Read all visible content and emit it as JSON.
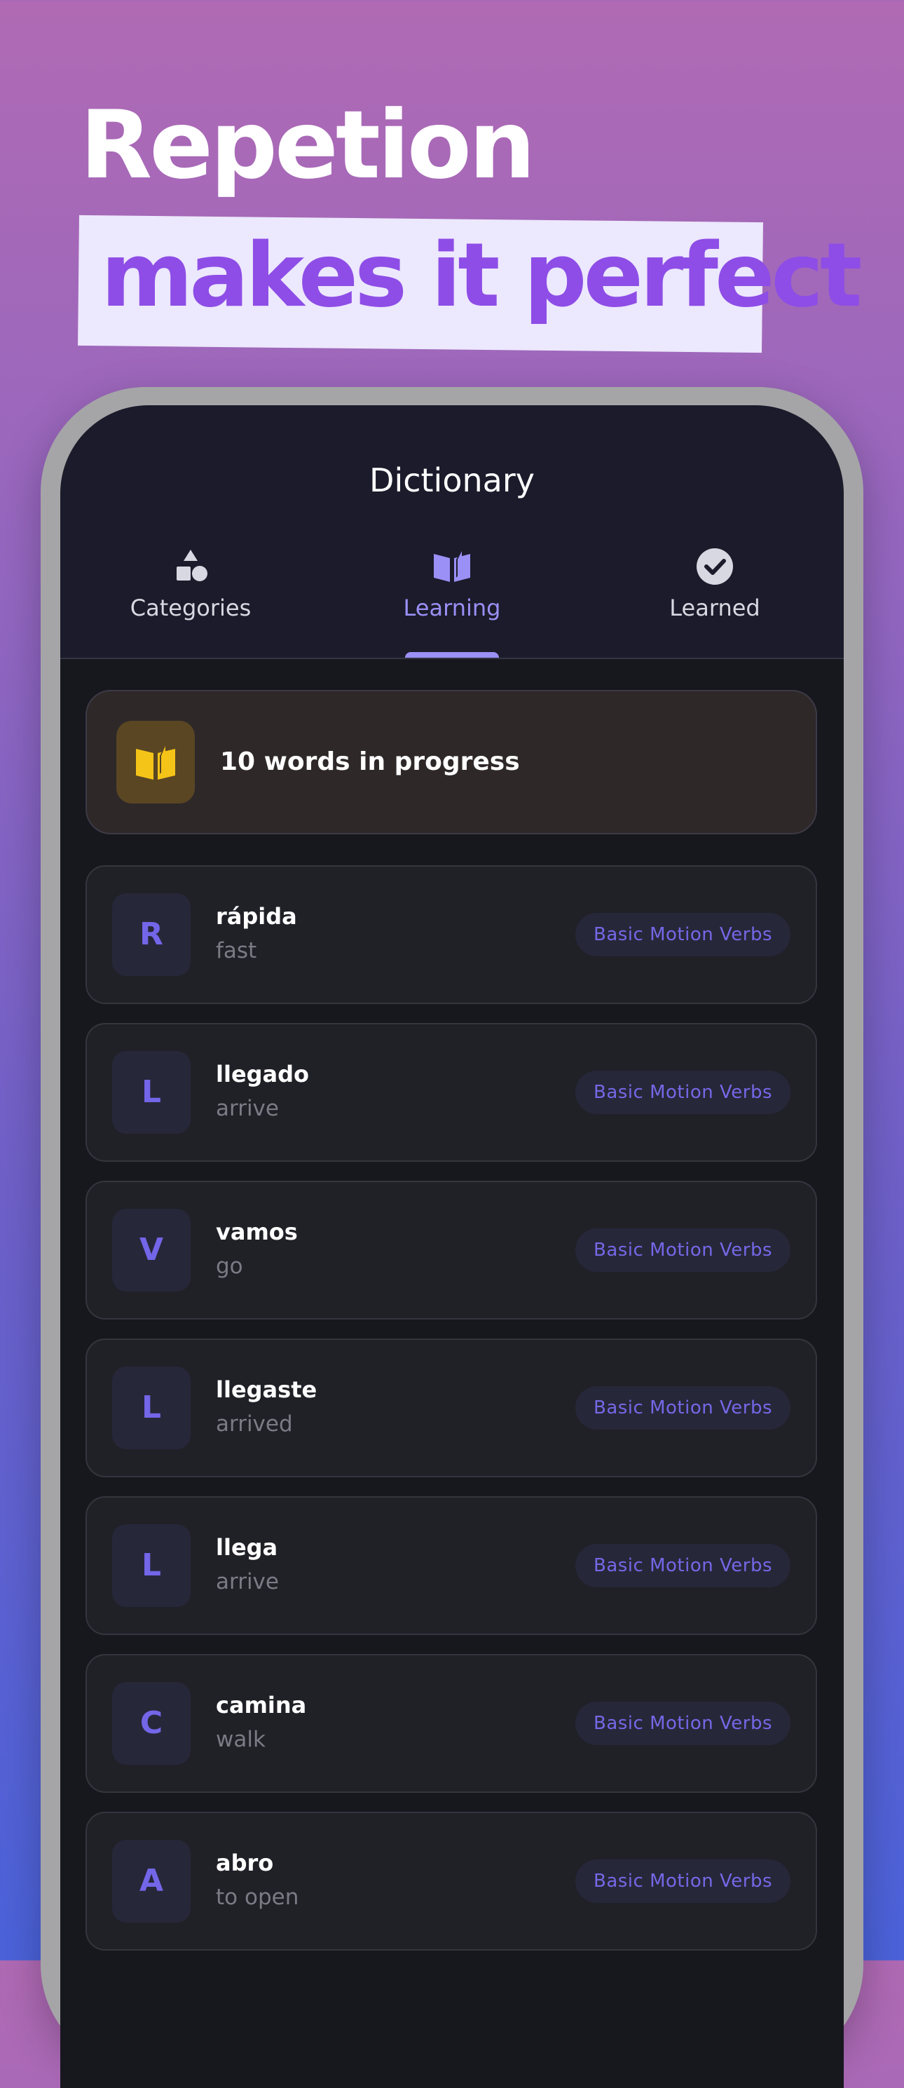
{
  "headline": {
    "line1": "Repetion",
    "line2": "makes it perfect"
  },
  "screen": {
    "title": "Dictionary",
    "tabs": [
      {
        "label": "Categories",
        "icon": "shapes-icon",
        "active": false
      },
      {
        "label": "Learning",
        "icon": "open-book-icon",
        "active": true
      },
      {
        "label": "Learned",
        "icon": "check-circle-icon",
        "active": false
      }
    ],
    "progress": {
      "text": "10 words in progress",
      "icon": "open-book-icon"
    },
    "words": [
      {
        "letter": "R",
        "word": "rápida",
        "translation": "fast",
        "category": "Basic Motion Verbs"
      },
      {
        "letter": "L",
        "word": "llegado",
        "translation": "arrive",
        "category": "Basic Motion Verbs"
      },
      {
        "letter": "V",
        "word": "vamos",
        "translation": "go",
        "category": "Basic Motion Verbs"
      },
      {
        "letter": "L",
        "word": "llegaste",
        "translation": "arrived",
        "category": "Basic Motion Verbs"
      },
      {
        "letter": "L",
        "word": "llega",
        "translation": "arrive",
        "category": "Basic Motion Verbs"
      },
      {
        "letter": "C",
        "word": "camina",
        "translation": "walk",
        "category": "Basic Motion Verbs"
      },
      {
        "letter": "A",
        "word": "abro",
        "translation": "to open",
        "category": "Basic Motion Verbs"
      }
    ]
  },
  "colors": {
    "accent": "#9a90f5",
    "headline_highlight": "#8e4de6",
    "progress_icon": "#f5c418"
  }
}
